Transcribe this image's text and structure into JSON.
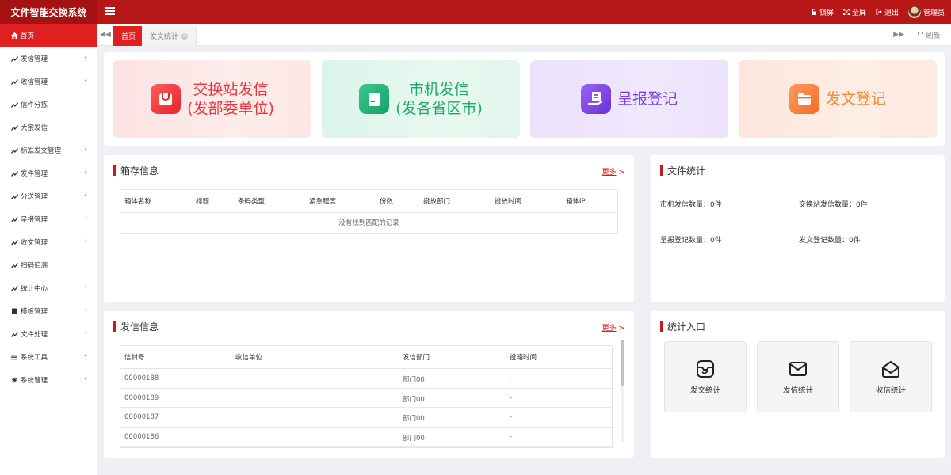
{
  "app": {
    "title": "文件智能交换系统"
  },
  "topbar": {
    "lock": "锁屏",
    "fullscreen": "全屏",
    "logout": "退出",
    "user": "管理员"
  },
  "sidebar": {
    "items": [
      {
        "label": "首页",
        "icon": "home-icon",
        "expandable": false,
        "active": true
      },
      {
        "label": "发信管理",
        "icon": "tools-icon",
        "expandable": true
      },
      {
        "label": "收信管理",
        "icon": "tools-icon",
        "expandable": true
      },
      {
        "label": "信件分拣",
        "icon": "tools-icon",
        "expandable": false
      },
      {
        "label": "大宗发信",
        "icon": "tools-icon",
        "expandable": false
      },
      {
        "label": "标准发文管理",
        "icon": "tools-icon",
        "expandable": true
      },
      {
        "label": "发件管理",
        "icon": "tools-icon",
        "expandable": true
      },
      {
        "label": "分送管理",
        "icon": "tools-icon",
        "expandable": true
      },
      {
        "label": "呈报管理",
        "icon": "tools-icon",
        "expandable": true
      },
      {
        "label": "收文管理",
        "icon": "tools-icon",
        "expandable": true
      },
      {
        "label": "扫码追溯",
        "icon": "tools-icon",
        "expandable": false
      },
      {
        "label": "统计中心",
        "icon": "tools-icon",
        "expandable": true
      },
      {
        "label": "模板管理",
        "icon": "book-icon",
        "expandable": true
      },
      {
        "label": "文件处理",
        "icon": "tools-icon",
        "expandable": true
      },
      {
        "label": "系统工具",
        "icon": "bars-icon",
        "expandable": true
      },
      {
        "label": "系统管理",
        "icon": "gear-icon",
        "expandable": true
      }
    ]
  },
  "tabs": {
    "items": [
      {
        "label": "首页",
        "active": true
      },
      {
        "label": "发文统计",
        "active": false
      }
    ],
    "refresh": "刷新"
  },
  "banner": {
    "cards": [
      {
        "line1": "交换站发信",
        "line2": "(发部委单位)",
        "color": "#e8363c"
      },
      {
        "line1": "市机发信",
        "line2": "(发各省区市)",
        "color": "#1fa971"
      },
      {
        "line1": "呈报登记",
        "line2": "",
        "color": "#7b3fe4"
      },
      {
        "line1": "发文登记",
        "line2": "",
        "color": "#f08a3c"
      }
    ]
  },
  "box_panel": {
    "title": "箱存信息",
    "more": "更多",
    "columns": [
      "箱体名称",
      "标题",
      "条码类型",
      "紧急程度",
      "份数",
      "投放部门",
      "投放时间",
      "箱体IP"
    ],
    "empty_text": "没有找到匹配的记录"
  },
  "send_panel": {
    "title": "发信信息",
    "more": "更多",
    "columns": [
      "信封号",
      "收信单位",
      "发信部门",
      "投箱时间"
    ],
    "rows": [
      [
        "00000188",
        "",
        "部门00",
        "-"
      ],
      [
        "00000189",
        "",
        "部门00",
        "-"
      ],
      [
        "00000187",
        "",
        "部门00",
        "-"
      ],
      [
        "00000186",
        "",
        "部门00",
        "-"
      ]
    ]
  },
  "file_stats": {
    "title": "文件统计",
    "items": [
      "市机发信数量：0件",
      "交换站发信数量：0件",
      "呈报登记数量：0件",
      "发文登记数量：0件"
    ]
  },
  "stat_entry": {
    "title": "统计入口",
    "buttons": [
      {
        "label": "发文统计",
        "icon": "inbox-check-icon"
      },
      {
        "label": "发信统计",
        "icon": "envelope-icon"
      },
      {
        "label": "收信统计",
        "icon": "envelope-open-icon"
      }
    ]
  },
  "colors": {
    "brand": "#b81717",
    "active": "#e02020",
    "accent": "#c81a1a"
  }
}
